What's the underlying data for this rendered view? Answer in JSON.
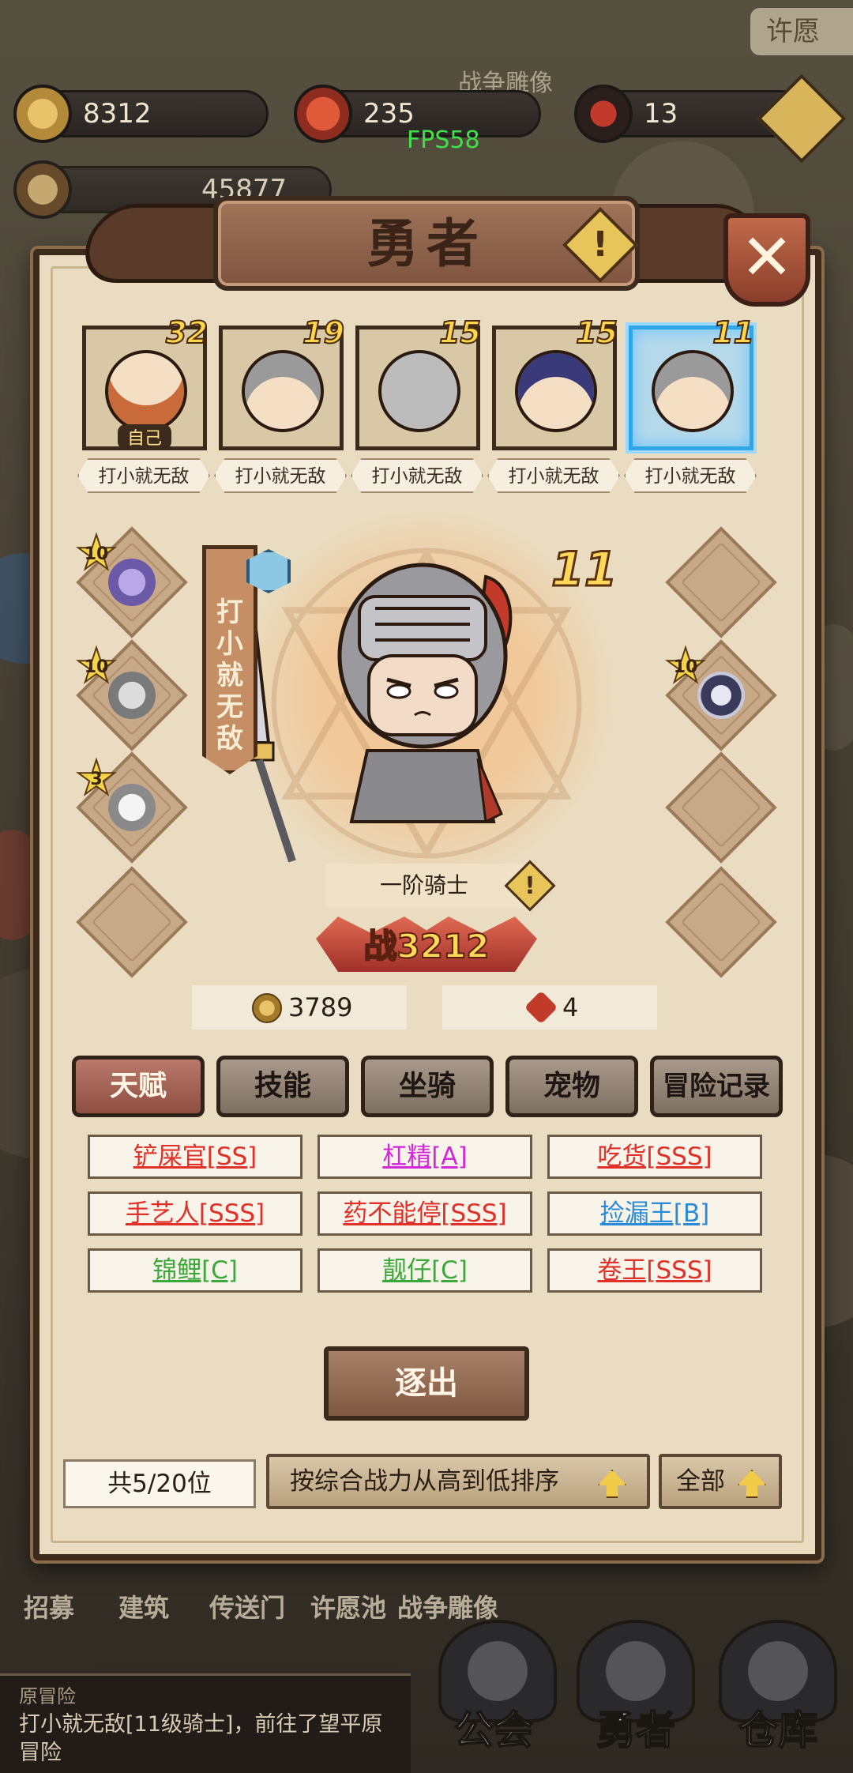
{
  "top_bar": {
    "gold": "8312",
    "honor": "235",
    "spirit": "13",
    "power_partial": "45877",
    "fps": "FPS58",
    "top_right_label": "许愿",
    "background_label": "战争雕像"
  },
  "panel": {
    "title": "勇者",
    "info_symbol": "!",
    "close_symbol": "✕"
  },
  "heroes": [
    {
      "level": "32",
      "name": "打小就无敌",
      "self_tag": "自己",
      "selected": false
    },
    {
      "level": "19",
      "name": "打小就无敌",
      "selected": false
    },
    {
      "level": "15",
      "name": "打小就无敌",
      "selected": false
    },
    {
      "level": "15",
      "name": "打小就无敌",
      "selected": false
    },
    {
      "level": "11",
      "name": "打小就无敌",
      "selected": true
    }
  ],
  "equipment_left": [
    {
      "stars": "10",
      "item": "purple-feather-icon"
    },
    {
      "stars": "10",
      "item": "armor-icon"
    },
    {
      "stars": "3",
      "item": "helmet-icon"
    },
    {
      "stars": "",
      "item": ""
    }
  ],
  "equipment_right": [
    {
      "stars": "",
      "item": ""
    },
    {
      "stars": "10",
      "item": "ring-icon"
    },
    {
      "stars": "",
      "item": ""
    },
    {
      "stars": "",
      "item": ""
    }
  ],
  "selected_hero": {
    "title_banner": "打小就无敌",
    "level": "11",
    "class_name": "一阶骑士",
    "power_label": "战3212",
    "gold": "3789",
    "honor": "4"
  },
  "category_tabs": [
    "天赋",
    "技能",
    "坐骑",
    "宠物",
    "冒险记录"
  ],
  "talents": [
    {
      "label": "铲屎官[SS]",
      "color": "#e0302a"
    },
    {
      "label": "杠精[A]",
      "color": "#d02ad8"
    },
    {
      "label": "吃货[SSS]",
      "color": "#e0302a"
    },
    {
      "label": "手艺人[SSS]",
      "color": "#e0302a"
    },
    {
      "label": "药不能停[SSS]",
      "color": "#e0302a"
    },
    {
      "label": "捡漏王[B]",
      "color": "#2a8ad8"
    },
    {
      "label": "锦鲤[C]",
      "color": "#3aa83a"
    },
    {
      "label": "靓仔[C]",
      "color": "#3aa83a"
    },
    {
      "label": "卷王[SSS]",
      "color": "#e0302a"
    }
  ],
  "expel_label": "逐出",
  "footer": {
    "count": "共5/20位",
    "sort_label": "按综合战力从高到低排序",
    "filter_label": "全部"
  },
  "nav_strip": [
    "招募",
    "建筑",
    "传送门",
    "许愿池",
    "战争雕像"
  ],
  "log": {
    "title": "原冒险",
    "text": "打小就无敌[11级骑士]，前往了望平原冒险"
  },
  "bottom_tabs": [
    "公会",
    "勇者",
    "仓库"
  ]
}
